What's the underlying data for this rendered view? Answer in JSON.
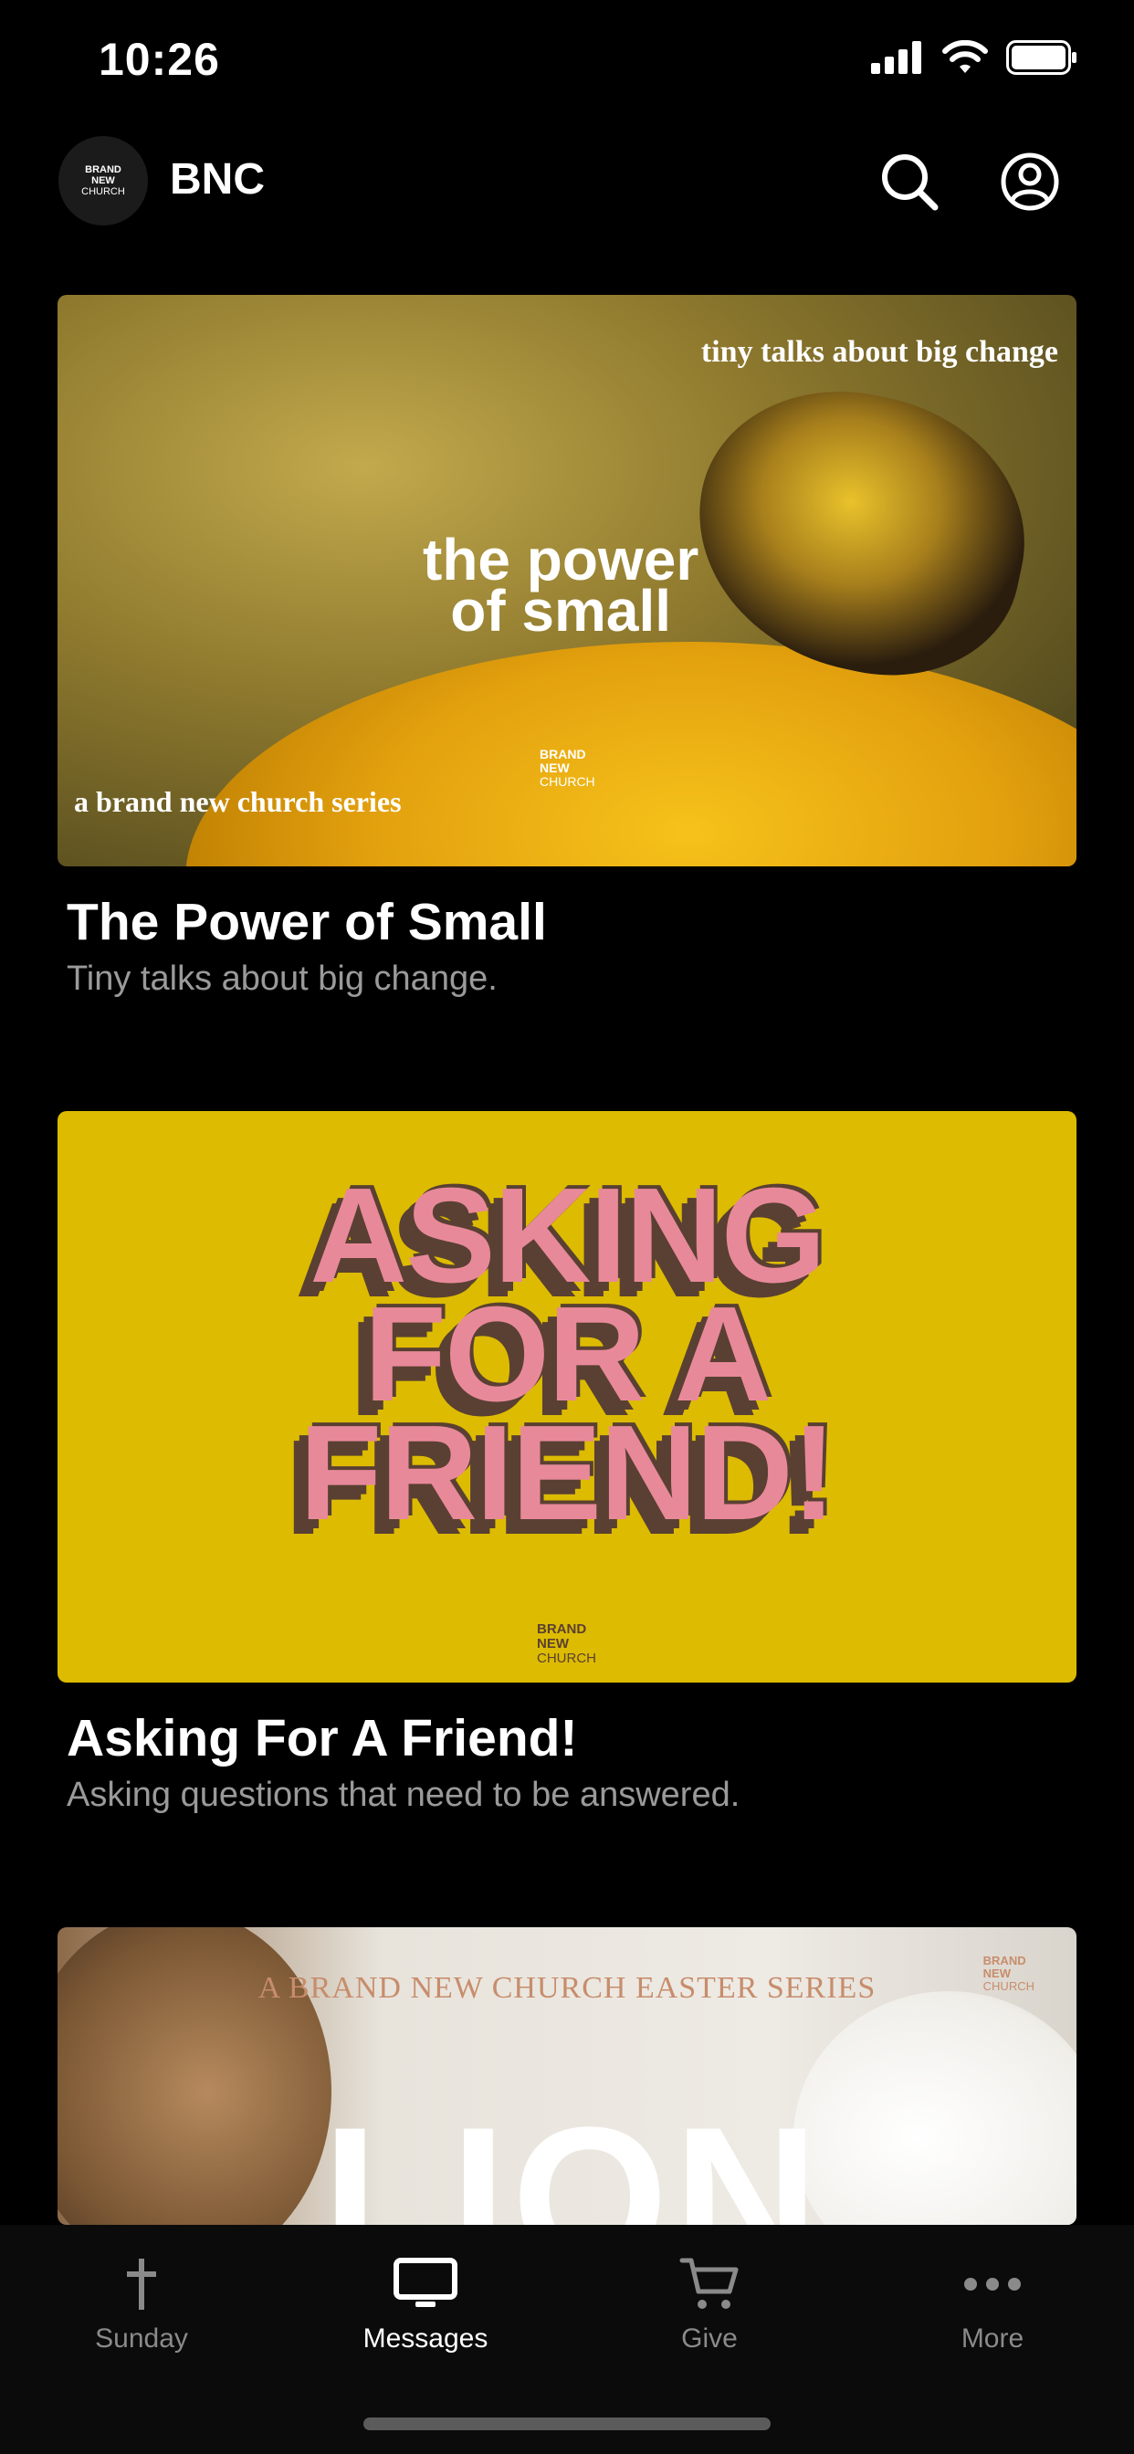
{
  "status_bar": {
    "time": "10:26"
  },
  "header": {
    "logo_text": [
      "BRAND",
      "NEW",
      "CHURCH"
    ],
    "title": "BNC"
  },
  "cards": [
    {
      "title": "The Power of Small",
      "subtitle": "Tiny talks about big change.",
      "art": {
        "tagline": "tiny talks about big change",
        "headline_1": "the power",
        "headline_2": "of small",
        "series": "a brand new church series",
        "logo_text": [
          "BRAND",
          "NEW",
          "CHURCH"
        ]
      }
    },
    {
      "title": "Asking For A Friend!",
      "subtitle": "Asking questions that need to be answered.",
      "art": {
        "headline_1": "ASKING",
        "headline_2": "FOR A",
        "headline_3": "FRIEND!",
        "logo_text": [
          "BRAND",
          "NEW",
          "CHURCH"
        ]
      }
    },
    {
      "art": {
        "series": "A BRAND NEW CHURCH EASTER SERIES",
        "headline": "LION",
        "logo_text": [
          "BRAND",
          "NEW",
          "CHURCH"
        ]
      }
    }
  ],
  "tabbar": {
    "tabs": [
      {
        "label": "Sunday",
        "icon": "cross-icon",
        "active": false
      },
      {
        "label": "Messages",
        "icon": "tv-icon",
        "active": true
      },
      {
        "label": "Give",
        "icon": "cart-icon",
        "active": false
      },
      {
        "label": "More",
        "icon": "ellipsis-icon",
        "active": false
      }
    ]
  },
  "colors": {
    "background": "#000000",
    "inactive": "#8a8a8a",
    "card2_bg": "#ddbb00",
    "card2_text": "#e8899a"
  }
}
